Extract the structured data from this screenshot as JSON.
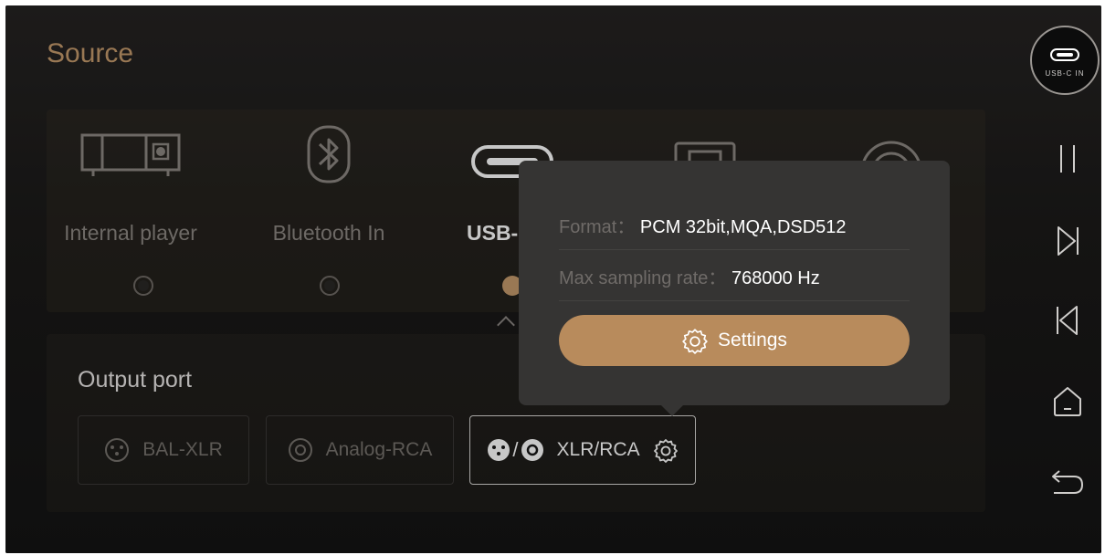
{
  "page": {
    "title": "Source"
  },
  "sources": [
    {
      "label": "Internal player",
      "icon": "internal-player-icon",
      "selected": false
    },
    {
      "label": "Bluetooth In",
      "icon": "bluetooth-icon",
      "selected": false
    },
    {
      "label": "USB-",
      "icon": "usb-c-icon",
      "selected": true
    }
  ],
  "output": {
    "title": "Output port",
    "ports": [
      {
        "label": "BAL-XLR",
        "icon": "xlr-icon",
        "selected": false
      },
      {
        "label": "Analog-RCA",
        "icon": "rca-icon",
        "selected": false
      },
      {
        "label": "XLR/RCA",
        "icon": "xlr-rca-icon",
        "selected": true
      }
    ]
  },
  "popup": {
    "format_label": "Format：",
    "format_value": "PCM 32bit,MQA,DSD512",
    "rate_label": "Max sampling rate：",
    "rate_value": "768000 Hz",
    "settings_label": "Settings"
  },
  "rail": {
    "badge_text": "USB-C IN",
    "buttons": [
      "pause-icon",
      "next-icon",
      "previous-icon",
      "home-icon",
      "back-icon"
    ]
  },
  "colors": {
    "accent": "#c49a6c",
    "button": "#b88b5c",
    "background": "#181818"
  }
}
